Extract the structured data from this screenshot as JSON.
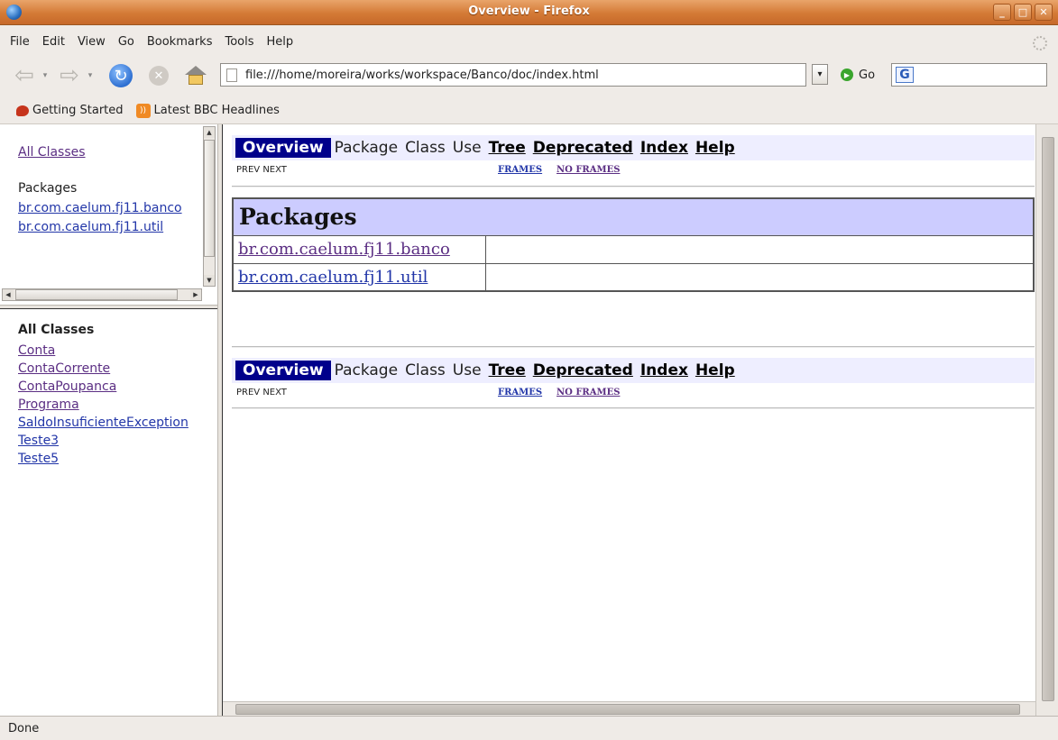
{
  "window": {
    "title": "Overview - Firefox"
  },
  "menubar": {
    "items": [
      "File",
      "Edit",
      "View",
      "Go",
      "Bookmarks",
      "Tools",
      "Help"
    ]
  },
  "toolbar": {
    "url": "file:///home/moreira/works/workspace/Banco/doc/index.html",
    "go_label": "Go",
    "search_engine_letter": "G"
  },
  "bookmarks": [
    {
      "label": "Getting Started",
      "icon": "firefox-icon"
    },
    {
      "label": "Latest BBC Headlines",
      "icon": "rss-icon"
    }
  ],
  "left_top": {
    "all_classes_link": "All Classes",
    "packages_heading": "Packages",
    "packages": [
      "br.com.caelum.fj11.banco",
      "br.com.caelum.fj11.util"
    ]
  },
  "left_bottom": {
    "heading": "All Classes",
    "classes": [
      "Conta",
      "ContaCorrente",
      "ContaPoupanca",
      "Programa",
      "SaldoInsuficienteException",
      "Teste3",
      "Teste5"
    ]
  },
  "main": {
    "nav": {
      "overview": "Overview",
      "package": "Package",
      "class": "Class",
      "use": "Use",
      "tree": "Tree",
      "deprecated": "Deprecated",
      "index": "Index",
      "help": "Help"
    },
    "subnav": {
      "prev_next": "PREV   NEXT",
      "frames": "FRAMES",
      "no_frames": "NO FRAMES"
    },
    "packages_table": {
      "heading": "Packages",
      "rows": [
        "br.com.caelum.fj11.banco",
        "br.com.caelum.fj11.util"
      ]
    }
  },
  "status": {
    "text": "Done"
  },
  "colors": {
    "nav_active_bg": "#00008b",
    "table_header_bg": "#ccccff",
    "nav_bar_bg": "#eeeeff",
    "titlebar": "#d47a36"
  }
}
